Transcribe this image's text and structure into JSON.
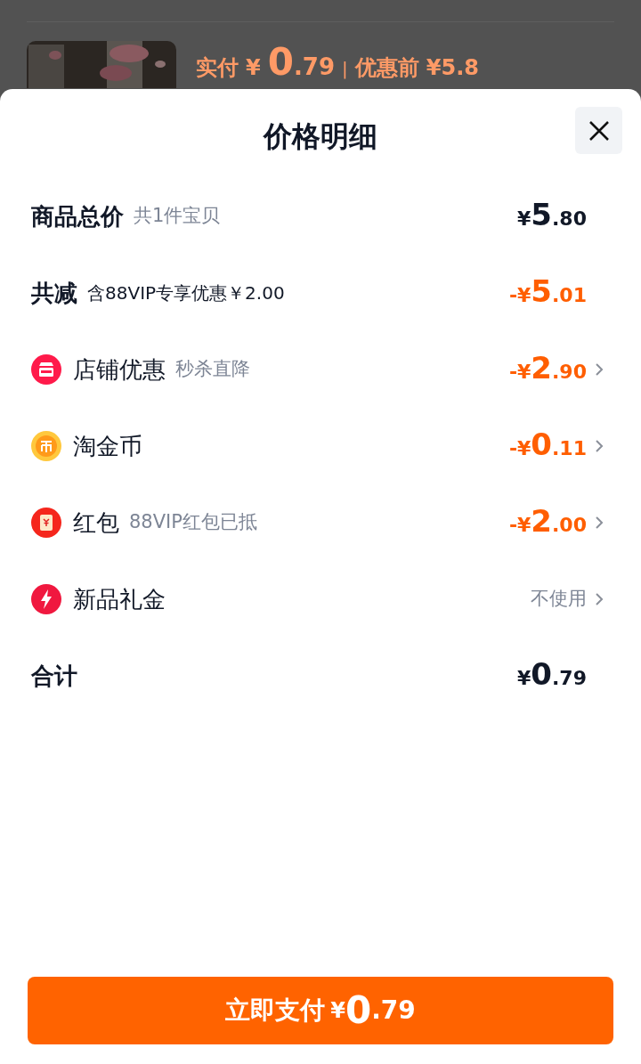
{
  "background": {
    "price_label": "实付",
    "price_symbol": "¥",
    "price_integer": "0",
    "price_decimal": ".79",
    "separator": "|",
    "original_label": "优惠前",
    "original_price": "¥5.8"
  },
  "sheet": {
    "title": "价格明细",
    "rows": [
      {
        "kind": "total",
        "label": "商品总价",
        "note": "共1件宝贝",
        "value": {
          "kind": "amount",
          "symbol": "¥",
          "integer": "5",
          "decimal": ".80"
        },
        "chevron": false
      },
      {
        "kind": "reduction",
        "label": "共减",
        "note": "含88VIP专享优惠￥2.00",
        "value": {
          "kind": "discount",
          "symbol": "-¥",
          "integer": "5",
          "decimal": ".01"
        },
        "chevron": false
      },
      {
        "kind": "item",
        "label": "店铺优惠",
        "note": "秒杀直降",
        "value": {
          "kind": "discount",
          "symbol": "-¥",
          "integer": "2",
          "decimal": ".90"
        },
        "chevron": true
      },
      {
        "kind": "item",
        "label": "淘金币",
        "value": {
          "kind": "discount",
          "symbol": "-¥",
          "integer": "0",
          "decimal": ".11"
        },
        "chevron": true
      },
      {
        "kind": "item",
        "label": "红包",
        "note": "88VIP红包已抵",
        "value": {
          "kind": "discount",
          "symbol": "-¥",
          "integer": "2",
          "decimal": ".00"
        },
        "chevron": true
      },
      {
        "kind": "item",
        "label": "新品礼金",
        "value": {
          "kind": "text",
          "text": "不使用"
        },
        "chevron": true
      },
      {
        "kind": "total",
        "label": "合计",
        "value": {
          "kind": "amount",
          "symbol": "¥",
          "integer": "0",
          "decimal": ".79"
        },
        "chevron": false
      }
    ],
    "pay_button": {
      "label": "立即支付",
      "symbol": "¥",
      "integer": "0",
      "decimal": ".79"
    }
  }
}
